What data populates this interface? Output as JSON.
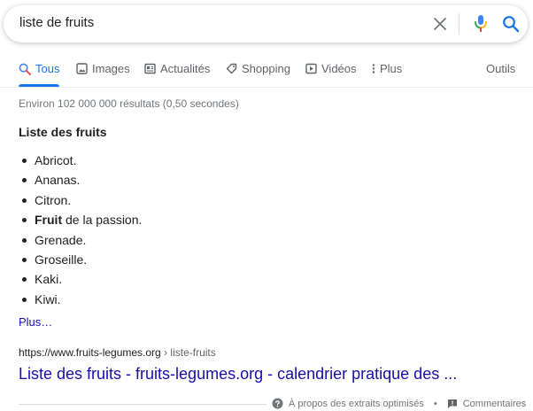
{
  "search": {
    "query": "liste de fruits"
  },
  "tabs": [
    {
      "label": "Tous",
      "icon": "search-icon"
    },
    {
      "label": "Images",
      "icon": "image-icon"
    },
    {
      "label": "Actualités",
      "icon": "newspaper-icon"
    },
    {
      "label": "Shopping",
      "icon": "tag-icon"
    },
    {
      "label": "Vidéos",
      "icon": "video-icon"
    },
    {
      "label": "Plus",
      "icon": "more-vert-icon"
    },
    {
      "label": "Outils"
    }
  ],
  "results_stats": "Environ 102 000 000 résultats (0,50 secondes)",
  "snippet": {
    "title": "Liste des fruits",
    "items": [
      {
        "bold": "",
        "text": "Abricot."
      },
      {
        "bold": "",
        "text": "Ananas."
      },
      {
        "bold": "",
        "text": "Citron."
      },
      {
        "bold": "Fruit",
        "text": " de la passion."
      },
      {
        "bold": "",
        "text": "Grenade."
      },
      {
        "bold": "",
        "text": "Groseille."
      },
      {
        "bold": "",
        "text": "Kaki."
      },
      {
        "bold": "",
        "text": "Kiwi."
      }
    ],
    "more_label": "Plus…"
  },
  "result": {
    "url": "https://www.fruits-legumes.org",
    "breadcrumb": " › liste-fruits",
    "title": "Liste des fruits - fruits-legumes.org - calendrier pratique des ..."
  },
  "footer": {
    "about_label": "À propos des extraits optimisés",
    "separator": "•",
    "feedback_label": "Commentaires"
  },
  "colors": {
    "accent": "#1a73e8",
    "link": "#1a0dab",
    "muted": "#5f6368"
  }
}
